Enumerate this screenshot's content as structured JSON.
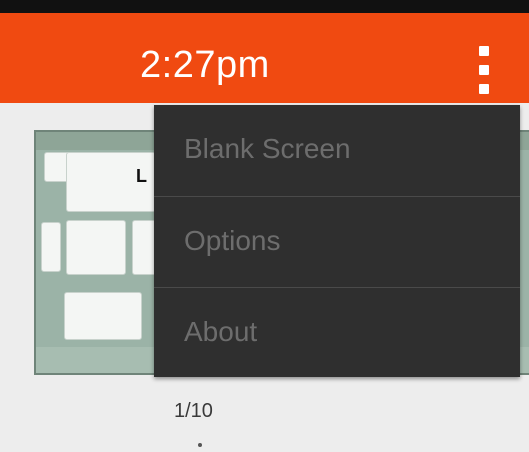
{
  "status": {
    "time": "2:27pm"
  },
  "action_bar": {
    "accent_color": "#f04a11",
    "overflow_icon": "more-vertical-icon"
  },
  "menu": {
    "items": [
      {
        "label": "Blank Screen"
      },
      {
        "label": "Options"
      },
      {
        "label": "About"
      }
    ]
  },
  "thumbnail": {
    "key_text": "L"
  },
  "pager": {
    "indicator": "1/10"
  }
}
